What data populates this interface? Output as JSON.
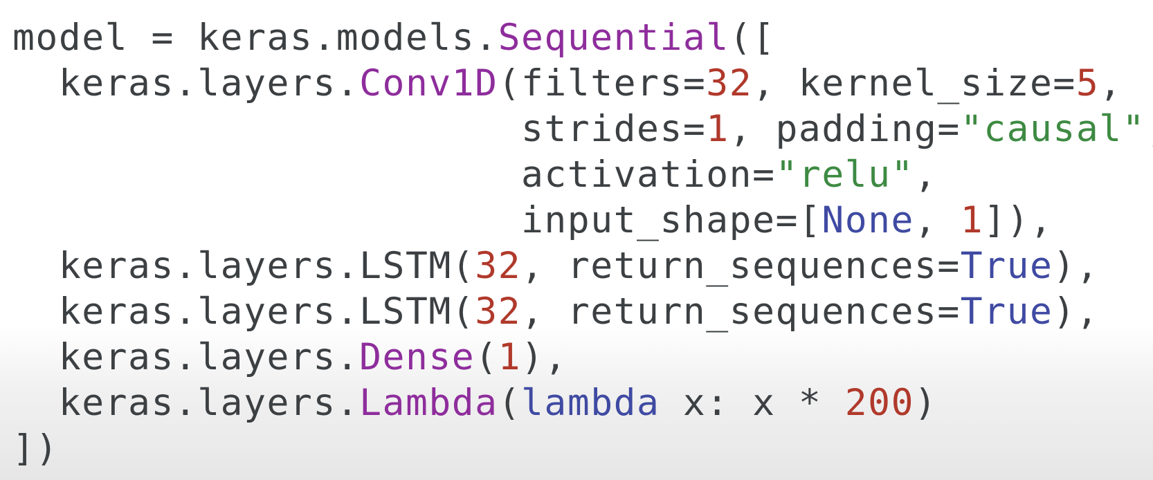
{
  "code": {
    "lines": [
      [
        {
          "text": "model = keras.models.",
          "t": "plain"
        },
        {
          "text": "Sequential",
          "t": "fn"
        },
        {
          "text": "([",
          "t": "plain"
        }
      ],
      [
        {
          "text": "  keras.layers.",
          "t": "plain"
        },
        {
          "text": "Conv1D",
          "t": "fn"
        },
        {
          "text": "(filters=",
          "t": "plain"
        },
        {
          "text": "32",
          "t": "num"
        },
        {
          "text": ", kernel_size=",
          "t": "plain"
        },
        {
          "text": "5",
          "t": "num"
        },
        {
          "text": ",",
          "t": "plain"
        }
      ],
      [
        {
          "text": "                      strides=",
          "t": "plain"
        },
        {
          "text": "1",
          "t": "num"
        },
        {
          "text": ", padding=",
          "t": "plain"
        },
        {
          "text": "\"causal\"",
          "t": "str"
        },
        {
          "text": ",",
          "t": "plain"
        }
      ],
      [
        {
          "text": "                      activation=",
          "t": "plain"
        },
        {
          "text": "\"relu\"",
          "t": "str"
        },
        {
          "text": ",",
          "t": "plain"
        }
      ],
      [
        {
          "text": "                      input_shape=[",
          "t": "plain"
        },
        {
          "text": "None",
          "t": "kw"
        },
        {
          "text": ", ",
          "t": "plain"
        },
        {
          "text": "1",
          "t": "num"
        },
        {
          "text": "]),",
          "t": "plain"
        }
      ],
      [
        {
          "text": "  keras.layers.LSTM(",
          "t": "plain"
        },
        {
          "text": "32",
          "t": "num"
        },
        {
          "text": ", return_sequences=",
          "t": "plain"
        },
        {
          "text": "True",
          "t": "kw"
        },
        {
          "text": "),",
          "t": "plain"
        }
      ],
      [
        {
          "text": "  keras.layers.LSTM(",
          "t": "plain"
        },
        {
          "text": "32",
          "t": "num"
        },
        {
          "text": ", return_sequences=",
          "t": "plain"
        },
        {
          "text": "True",
          "t": "kw"
        },
        {
          "text": "),",
          "t": "plain"
        }
      ],
      [
        {
          "text": "  keras.layers.",
          "t": "plain"
        },
        {
          "text": "Dense",
          "t": "fn"
        },
        {
          "text": "(",
          "t": "plain"
        },
        {
          "text": "1",
          "t": "num"
        },
        {
          "text": "),",
          "t": "plain"
        }
      ],
      [
        {
          "text": "  keras.layers.",
          "t": "plain"
        },
        {
          "text": "Lambda",
          "t": "fn"
        },
        {
          "text": "(",
          "t": "plain"
        },
        {
          "text": "lambda",
          "t": "kw"
        },
        {
          "text": " x: x * ",
          "t": "plain"
        },
        {
          "text": "200",
          "t": "num"
        },
        {
          "text": ")",
          "t": "plain"
        }
      ],
      [
        {
          "text": "])",
          "t": "plain"
        }
      ]
    ]
  },
  "colors": {
    "plain": "#3c4043",
    "fn": "#8e2d9c",
    "num": "#b0392b",
    "str": "#3d8a42",
    "kw": "#3f4aa2"
  }
}
